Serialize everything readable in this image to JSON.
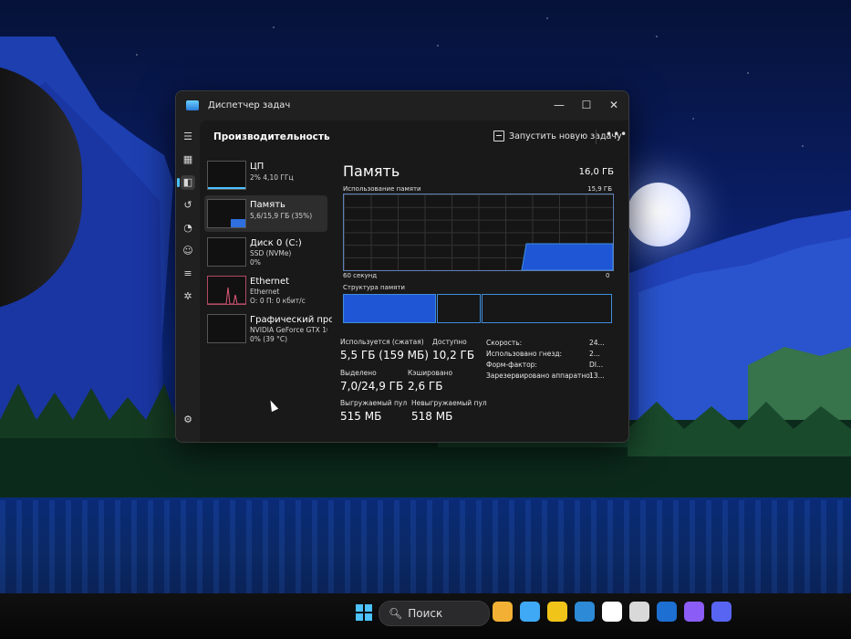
{
  "window": {
    "title": "Диспетчер задач",
    "minimize": "—",
    "maximize": "☐",
    "close": "✕"
  },
  "header": {
    "page_title": "Производительность",
    "run_task": "Запустить новую задачу",
    "more": "•••"
  },
  "rail_icons": [
    "menu-icon",
    "processes-icon",
    "performance-icon",
    "history-icon",
    "startup-icon",
    "users-icon",
    "details-icon",
    "services-icon"
  ],
  "list": [
    {
      "name": "ЦП",
      "sub1": "2% 4,10 ГГц",
      "sub2": "",
      "level": 0.02,
      "color": "#4cc2ff"
    },
    {
      "name": "Память",
      "sub1": "5,6/15,9 ГБ (35%)",
      "sub2": "",
      "level": 0.35,
      "color": "#2f6fe0"
    },
    {
      "name": "Диск 0 (C:)",
      "sub1": "SSD (NVMe)",
      "sub2": "0%",
      "level": 0.0,
      "color": "#59c36a"
    },
    {
      "name": "Ethernet",
      "sub1": "Ethernet",
      "sub2": "О: 0 П: 0 кбит/с",
      "level": 0.5,
      "color": "#e05a7a"
    },
    {
      "name": "Графический про",
      "sub1": "NVIDIA GeForce GTX 10",
      "sub2": "0% (39 °C)",
      "level": 0.0,
      "color": "#4cc2ff"
    }
  ],
  "memory": {
    "title": "Память",
    "total": "16,0 ГБ",
    "usage_label": "Использование памяти",
    "usage_max": "15,9 ГБ",
    "time_left": "60 секунд",
    "time_right": "0",
    "usage_fraction": 0.35,
    "structure_label": "Структура памяти"
  },
  "stats": {
    "in_use_label": "Используется (сжатая)",
    "in_use_value": "5,5 ГБ (159 МБ)",
    "available_label": "Доступно",
    "available_value": "10,2 ГБ",
    "committed_label": "Выделено",
    "committed_value": "7,0/24,9 ГБ",
    "cached_label": "Кэшировано",
    "cached_value": "2,6 ГБ",
    "paged_label": "Выгружаемый пул",
    "paged_value": "515 МБ",
    "nonpaged_label": "Невыгружаемый пул",
    "nonpaged_value": "518 МБ"
  },
  "properties": [
    {
      "key": "Скорость:",
      "value": "24..."
    },
    {
      "key": "Использовано гнезд:",
      "value": "2..."
    },
    {
      "key": "Форм-фактор:",
      "value": "DI..."
    },
    {
      "key": "Зарезервировано аппаратно:",
      "value": "13..."
    }
  ],
  "taskbar": {
    "search_placeholder": "Поиск",
    "app_colors": [
      "#f2b134",
      "#3fa9f5",
      "#f0c419",
      "#2c8ad6",
      "#ffffff",
      "#d9d9d9",
      "#1d6fd1",
      "#8b5cf6",
      "#5865f2"
    ]
  }
}
